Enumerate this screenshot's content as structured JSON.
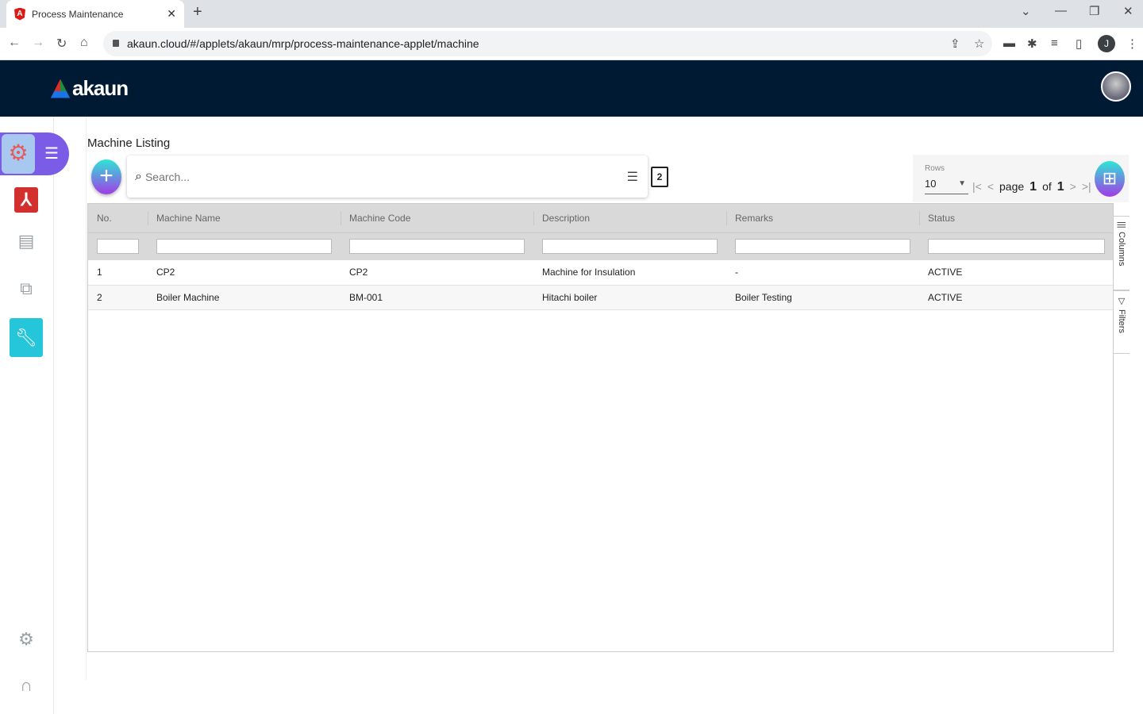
{
  "browser": {
    "tab_title": "Process Maintenance",
    "url": "akaun.cloud/#/applets/akaun/mrp/process-maintenance-applet/machine",
    "profile_initial": "J"
  },
  "app": {
    "logo_text": "akaun"
  },
  "page": {
    "title": "Machine Listing",
    "search_placeholder": "Search...",
    "copy_badge": "2"
  },
  "pager": {
    "rows_label": "Rows",
    "rows_value": "10",
    "page_word": "page",
    "page": "1",
    "of_word": "of",
    "total": "1"
  },
  "table": {
    "columns": [
      "No.",
      "Machine Name",
      "Machine Code",
      "Description",
      "Remarks",
      "Status"
    ],
    "rows": [
      [
        "1",
        "CP2",
        "CP2",
        "Machine for Insulation",
        "-",
        "ACTIVE"
      ],
      [
        "2",
        "Boiler Machine",
        "BM-001",
        "Hitachi boiler",
        "Boiler Testing",
        "ACTIVE"
      ]
    ]
  },
  "side_panel": {
    "columns": "Columns",
    "filters": "Filters"
  },
  "colors": {
    "header": "#001a33",
    "accent": "#26c6da",
    "badge": "#7b5ce6"
  }
}
